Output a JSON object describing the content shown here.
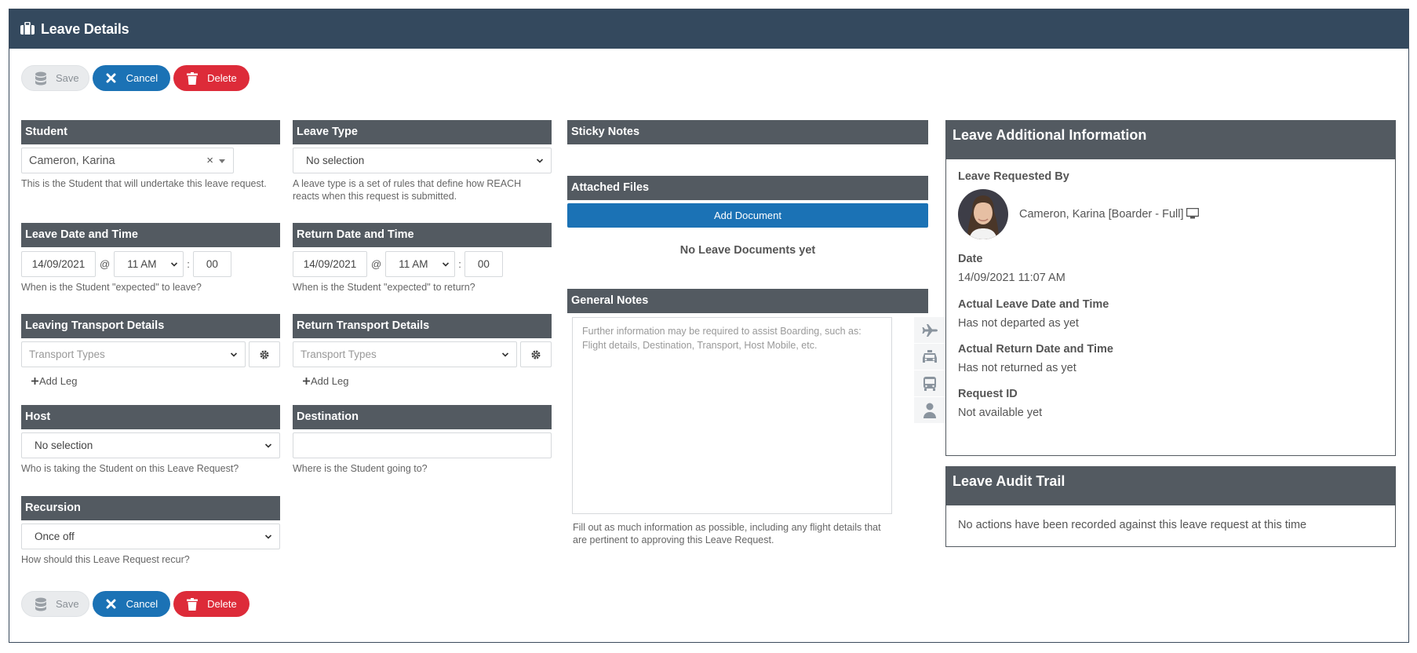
{
  "header": {
    "title": "Leave Details",
    "icon": "briefcase-icon"
  },
  "toolbar": {
    "save_label": "Save",
    "cancel_label": "Cancel",
    "delete_label": "Delete"
  },
  "student": {
    "heading": "Student",
    "value": "Cameron, Karina",
    "clear_symbol": "×",
    "help": "This is the Student that will undertake this leave request."
  },
  "leave_type": {
    "heading": "Leave Type",
    "value": "No selection",
    "help_line1": "A leave type is a set of rules that define how REACH",
    "help_line2": "reacts when this request is submitted."
  },
  "leave_datetime": {
    "heading": "Leave Date and Time",
    "date": "14/09/2021",
    "at": "@",
    "hour": "11 AM",
    "colon": ":",
    "minute": "00",
    "help": "When is the Student \"expected\" to leave?"
  },
  "return_datetime": {
    "heading": "Return Date and Time",
    "date": "14/09/2021",
    "at": "@",
    "hour": "11 AM",
    "colon": ":",
    "minute": "00",
    "help": "When is the Student \"expected\" to return?"
  },
  "leaving_transport": {
    "heading": "Leaving Transport Details",
    "placeholder": "Transport Types",
    "add_leg": "Add Leg"
  },
  "return_transport": {
    "heading": "Return Transport Details",
    "placeholder": "Transport Types",
    "add_leg": "Add Leg"
  },
  "host": {
    "heading": "Host",
    "value": "No selection",
    "help": "Who is taking the Student on this Leave Request?"
  },
  "destination": {
    "heading": "Destination",
    "value": "",
    "help": "Where is the Student going to?"
  },
  "recursion": {
    "heading": "Recursion",
    "value": "Once off",
    "help": "How should this Leave Request recur?"
  },
  "sticky_notes": {
    "heading": "Sticky Notes"
  },
  "attached_files": {
    "heading": "Attached Files",
    "add_button": "Add Document",
    "empty": "No Leave Documents yet"
  },
  "general_notes": {
    "heading": "General Notes",
    "placeholder_line1": "Further information may be required to assist Boarding, such as:",
    "placeholder_line2": "Flight details, Destination, Transport, Host Mobile, etc.",
    "help_line1": "Fill out as much information as possible, including any flight details that",
    "help_line2": "are pertinent to approving this Leave Request.",
    "side_icons": [
      "plane-icon",
      "taxi-icon",
      "bus-icon",
      "person-icon"
    ]
  },
  "additional_info": {
    "heading": "Leave Additional Information",
    "requested_by_label": "Leave Requested By",
    "requested_by_value": "Cameron, Karina [Boarder - Full]",
    "date_label": "Date",
    "date_value": "14/09/2021 11:07 AM",
    "actual_leave_label": "Actual Leave Date and Time",
    "actual_leave_value": "Has not departed as yet",
    "actual_return_label": "Actual Return Date and Time",
    "actual_return_value": "Has not returned as yet",
    "request_id_label": "Request ID",
    "request_id_value": "Not available yet"
  },
  "audit_trail": {
    "heading": "Leave Audit Trail",
    "message": "No actions have been recorded against this leave request at this time"
  },
  "colors": {
    "header": "#34495e",
    "section": "#535a61",
    "primary": "#1b72b5",
    "danger": "#dd2b39"
  }
}
